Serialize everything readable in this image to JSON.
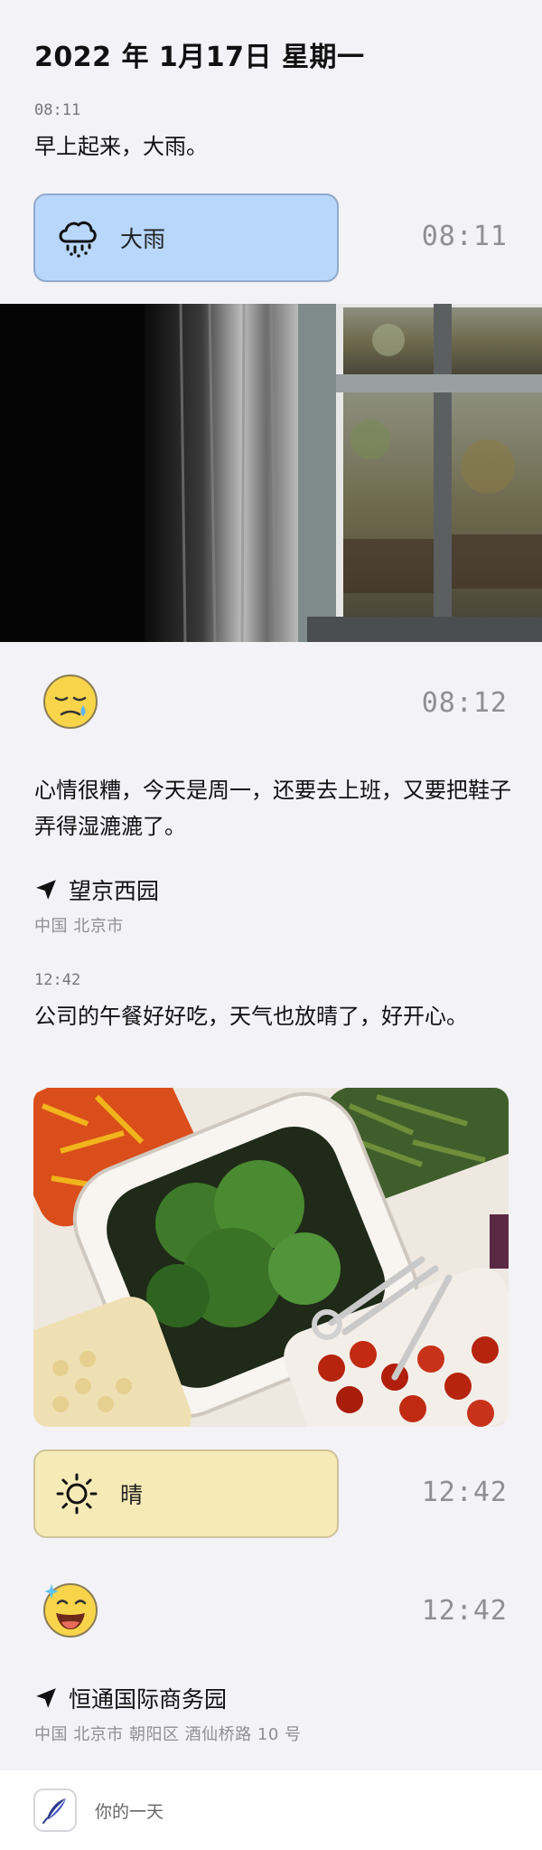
{
  "header": {
    "date_title": "2022 年 1月17日 星期一"
  },
  "entries": [
    {
      "time": "08:11",
      "text": "早上起来，大雨。",
      "weather": {
        "label": "大雨",
        "icon": "rain-cloud-icon",
        "time": "08:11",
        "color": "#b8d7fb"
      }
    },
    {
      "photo": "rainy-window-photo",
      "mood": {
        "icon": "sleepy-sad-face-icon",
        "time": "08:12"
      },
      "text": "心情很糟，今天是周一，还要去上班，又要把鞋子弄得湿漉漉了。",
      "location": {
        "name": "望京西园",
        "address": "中国 北京市"
      }
    },
    {
      "time": "12:42",
      "text": "公司的午餐好好吃，天气也放晴了，好开心。",
      "photo": "salad-bar-photo",
      "weather": {
        "label": "晴",
        "icon": "sun-icon",
        "time": "12:42",
        "color": "#f6eab7"
      },
      "mood": {
        "icon": "happy-face-icon",
        "time": "12:42"
      },
      "location": {
        "name": "恒通国际商务园",
        "address": "中国 北京市 朝阳区 酒仙桥路 10 号"
      }
    }
  ],
  "footer": {
    "app_name": "你的一天",
    "icon": "quill-pen-icon"
  }
}
